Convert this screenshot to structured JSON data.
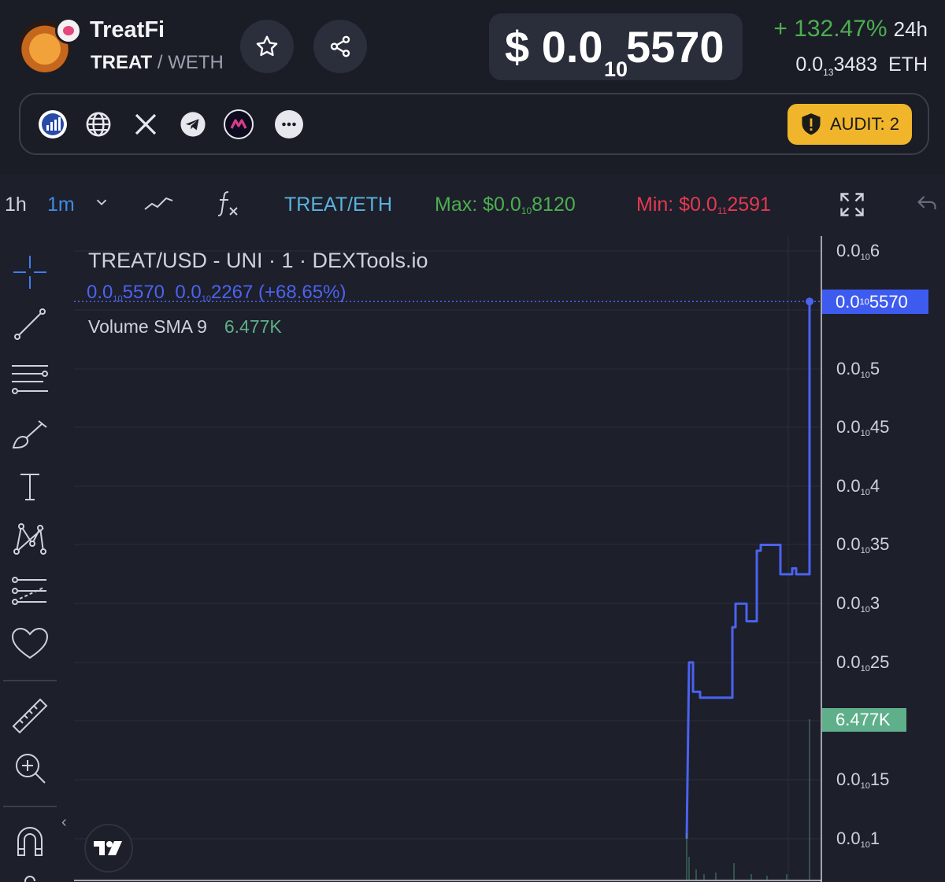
{
  "token": {
    "name": "TreatFi",
    "base": "TREAT",
    "sep": "/",
    "quote": "WETH"
  },
  "price": {
    "prefix": "$ 0.0",
    "zeros": "10",
    "digits": "5570"
  },
  "change": {
    "pct": "+ 132.47%",
    "period": "24h"
  },
  "eth_price": {
    "prefix": "0.0",
    "zeros": "13",
    "digits": "3483",
    "unit": "ETH"
  },
  "social": {
    "icons": [
      "chart-logo-icon",
      "globe-icon",
      "x-icon",
      "telegram-icon",
      "dextools-icon",
      "more-icon"
    ]
  },
  "audit": {
    "label": "AUDIT: 2"
  },
  "toolbar": {
    "interval_1h": "1h",
    "interval_1m": "1m",
    "pair_label": "TREAT/ETH",
    "max_prefix": "Max: $0.0",
    "max_zeros": "10",
    "max_digits": "8120",
    "min_prefix": "Min: $0.0",
    "min_zeros": "11",
    "min_digits": "2591"
  },
  "legend": {
    "title": "TREAT/USD - UNI · 1 · DEXTools.io",
    "last_prefix": "0.0",
    "last_zeros": "10",
    "last_digits": "5570",
    "chg_prefix": "0.0",
    "chg_zeros": "10",
    "chg_digits": "2267",
    "chg_pct": "(+68.65%)",
    "vol_label": "Volume SMA 9",
    "vol_value": "6.477K"
  },
  "yaxis": [
    {
      "p": "0.0",
      "z": "10",
      "d": "6"
    },
    {
      "p": "0.0",
      "z": "10",
      "d": "5"
    },
    {
      "p": "0.0",
      "z": "10",
      "d": "45"
    },
    {
      "p": "0.0",
      "z": "10",
      "d": "4"
    },
    {
      "p": "0.0",
      "z": "10",
      "d": "35"
    },
    {
      "p": "0.0",
      "z": "10",
      "d": "3"
    },
    {
      "p": "0.0",
      "z": "10",
      "d": "25"
    },
    {
      "p": "0.0",
      "z": "10",
      "d": "15"
    },
    {
      "p": "0.0",
      "z": "10",
      "d": "1"
    }
  ],
  "price_tag": {
    "p": "0.0",
    "z": "10",
    "d": "5570"
  },
  "vol_tag": "6.477K",
  "colors": {
    "line": "#4a63f0",
    "up": "#4caf50",
    "down": "#e53950",
    "audit": "#f0b52a",
    "volume": "#5fb08a"
  },
  "chart_data": {
    "type": "line",
    "series": [
      {
        "values": [
          [
            0,
            1.0
          ],
          [
            1,
            2.5
          ],
          [
            2,
            2.25
          ],
          [
            3,
            2.2
          ],
          [
            4,
            2.2
          ],
          [
            5,
            2.2
          ],
          [
            6,
            2.8
          ],
          [
            7,
            3.0
          ],
          [
            8,
            2.85
          ],
          [
            9,
            2.85
          ],
          [
            10,
            3.45
          ],
          [
            11,
            3.5
          ],
          [
            12,
            3.5
          ],
          [
            13,
            3.25
          ],
          [
            14,
            3.25
          ],
          [
            15,
            3.3
          ],
          [
            16,
            3.25
          ],
          [
            17,
            3.25
          ],
          [
            18,
            5.57
          ]
        ]
      }
    ]
  }
}
